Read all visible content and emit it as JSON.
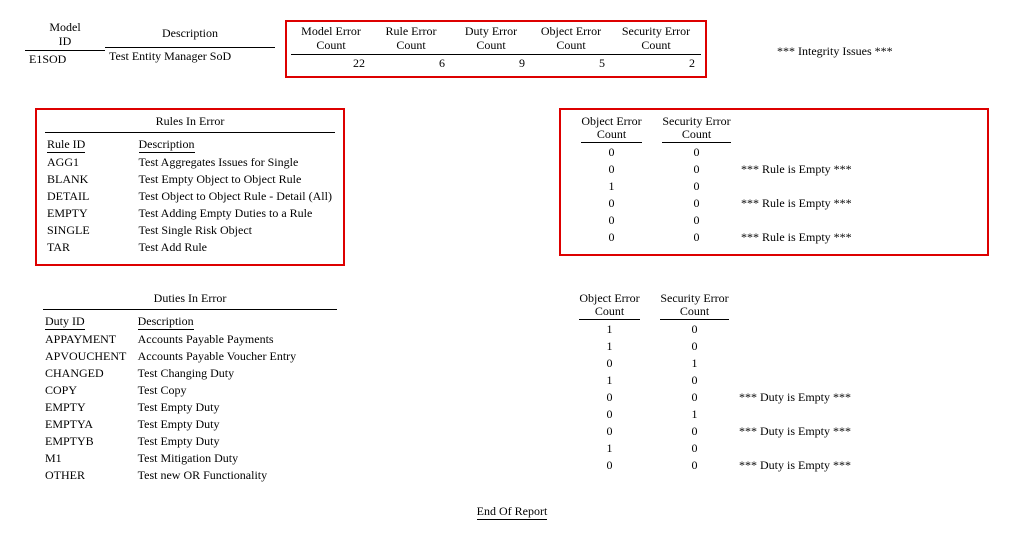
{
  "top": {
    "headers": {
      "model_id": "Model\nID",
      "description": "Description",
      "model_err": "Model Error\nCount",
      "rule_err": "Rule Error\nCount",
      "duty_err": "Duty Error\nCount",
      "obj_err": "Object Error\nCount",
      "sec_err": "Security Error\nCount"
    },
    "row": {
      "model_id": "E1SOD",
      "description": "Test Entity Manager SoD",
      "model_err": "22",
      "rule_err": "6",
      "duty_err": "9",
      "obj_err": "5",
      "sec_err": "2"
    },
    "integrity": "*** Integrity Issues ***"
  },
  "rules": {
    "title": "Rules In Error",
    "headers": {
      "id": "Rule ID",
      "desc": "Description"
    },
    "counts_headers": {
      "obj": "Object Error\nCount",
      "sec": "Security Error\nCount"
    },
    "rows": [
      {
        "id": "AGG1",
        "desc": "Test Aggregates Issues for Single",
        "obj": "0",
        "sec": "0",
        "msg": ""
      },
      {
        "id": "BLANK",
        "desc": "Test Empty Object to Object Rule",
        "obj": "0",
        "sec": "0",
        "msg": "*** Rule is Empty ***"
      },
      {
        "id": "DETAIL",
        "desc": "Test Object to Object Rule - Detail (All)",
        "obj": "1",
        "sec": "0",
        "msg": ""
      },
      {
        "id": "EMPTY",
        "desc": "Test Adding Empty Duties to a Rule",
        "obj": "0",
        "sec": "0",
        "msg": "*** Rule is Empty ***"
      },
      {
        "id": "SINGLE",
        "desc": "Test Single Risk Object",
        "obj": "0",
        "sec": "0",
        "msg": ""
      },
      {
        "id": "TAR",
        "desc": "Test Add Rule",
        "obj": "0",
        "sec": "0",
        "msg": "*** Rule is Empty ***"
      }
    ]
  },
  "duties": {
    "title": "Duties In Error",
    "headers": {
      "id": "Duty ID",
      "desc": "Description"
    },
    "counts_headers": {
      "obj": "Object Error\nCount",
      "sec": "Security Error\nCount"
    },
    "rows": [
      {
        "id": "APPAYMENT",
        "desc": "Accounts Payable Payments",
        "obj": "1",
        "sec": "0",
        "msg": ""
      },
      {
        "id": "APVOUCHENT",
        "desc": "Accounts Payable Voucher Entry",
        "obj": "1",
        "sec": "0",
        "msg": ""
      },
      {
        "id": "CHANGED",
        "desc": "Test Changing Duty",
        "obj": "0",
        "sec": "1",
        "msg": ""
      },
      {
        "id": "COPY",
        "desc": "Test Copy",
        "obj": "1",
        "sec": "0",
        "msg": ""
      },
      {
        "id": "EMPTY",
        "desc": "Test Empty Duty",
        "obj": "0",
        "sec": "0",
        "msg": "*** Duty is Empty ***"
      },
      {
        "id": "EMPTYA",
        "desc": "Test Empty Duty",
        "obj": "0",
        "sec": "1",
        "msg": ""
      },
      {
        "id": "EMPTYB",
        "desc": "Test Empty Duty",
        "obj": "0",
        "sec": "0",
        "msg": "*** Duty is Empty ***"
      },
      {
        "id": "M1",
        "desc": "Test Mitigation Duty",
        "obj": "1",
        "sec": "0",
        "msg": ""
      },
      {
        "id": "OTHER",
        "desc": "Test new OR Functionality",
        "obj": "0",
        "sec": "0",
        "msg": "*** Duty is Empty ***"
      }
    ]
  },
  "footer": {
    "end": "End Of Report"
  }
}
